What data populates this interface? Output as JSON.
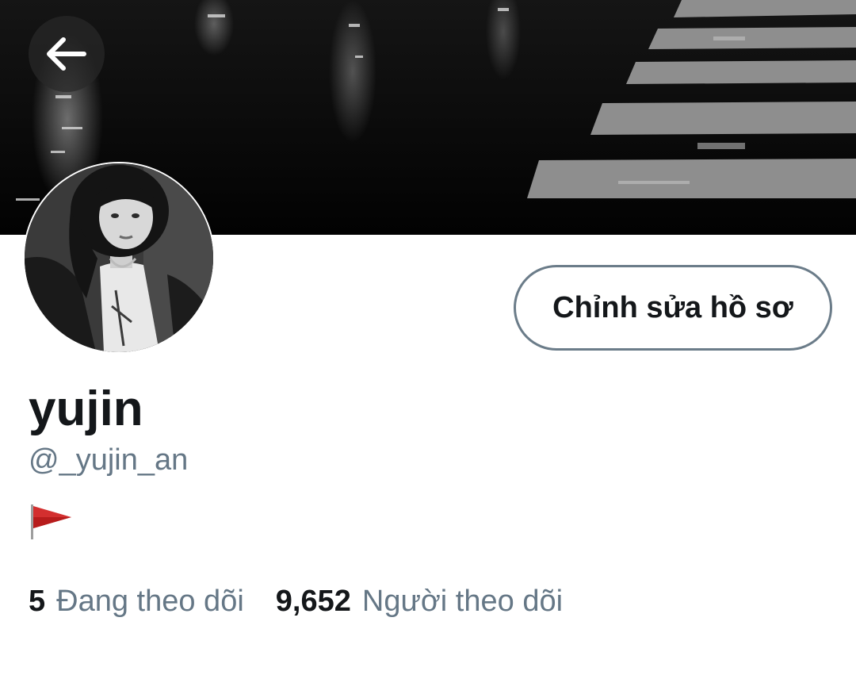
{
  "profile": {
    "display_name": "yujin",
    "handle": "@_yujin_an",
    "bio_icon": "red-flag-icon",
    "edit_label": "Chỉnh sửa hồ sơ"
  },
  "stats": {
    "following_count": "5",
    "following_label": "Đang theo dõi",
    "followers_count": "9,652",
    "followers_label": "Người theo dõi"
  },
  "icons": {
    "back": "arrow-left-icon"
  },
  "colors": {
    "text_primary": "#14171a",
    "text_secondary": "#657786",
    "button_border": "#6b7c89",
    "flag_red": "#d32f2f"
  }
}
